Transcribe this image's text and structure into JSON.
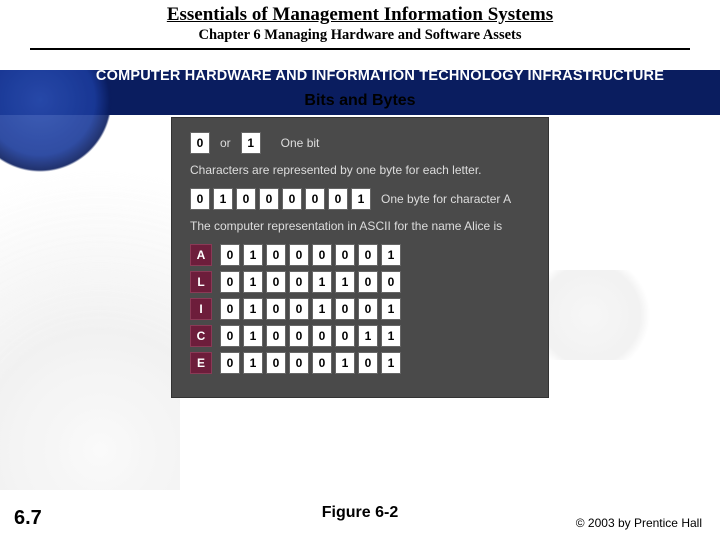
{
  "header": {
    "book_title": "Essentials of Management Information Systems",
    "chapter_line": "Chapter 6 Managing Hardware and Software Assets",
    "section_heading": "COMPUTER HARDWARE AND INFORMATION TECHNOLOGY INFRASTRUCTURE"
  },
  "slide": {
    "title": "Bits and Bytes",
    "bit_or_label": "or",
    "bit_row_caption": "One bit",
    "bit_values": [
      "0",
      "1"
    ],
    "byte_caption1": "Characters are represented by one byte for each letter.",
    "byte_sample_bits": [
      "0",
      "1",
      "0",
      "0",
      "0",
      "0",
      "0",
      "1"
    ],
    "byte_sample_label": "One byte for character A",
    "ascii_intro": "The computer representation in ASCII for the name Alice is",
    "ascii_rows": [
      {
        "letter": "A",
        "bits": [
          "0",
          "1",
          "0",
          "0",
          "0",
          "0",
          "0",
          "1"
        ]
      },
      {
        "letter": "L",
        "bits": [
          "0",
          "1",
          "0",
          "0",
          "1",
          "1",
          "0",
          "0"
        ]
      },
      {
        "letter": "I",
        "bits": [
          "0",
          "1",
          "0",
          "0",
          "1",
          "0",
          "0",
          "1"
        ]
      },
      {
        "letter": "C",
        "bits": [
          "0",
          "1",
          "0",
          "0",
          "0",
          "0",
          "1",
          "1"
        ]
      },
      {
        "letter": "E",
        "bits": [
          "0",
          "1",
          "0",
          "0",
          "0",
          "1",
          "0",
          "1"
        ]
      }
    ],
    "figure_label": "Figure 6-2"
  },
  "footer": {
    "page_number": "6.7",
    "copyright": "© 2003 by Prentice Hall"
  }
}
